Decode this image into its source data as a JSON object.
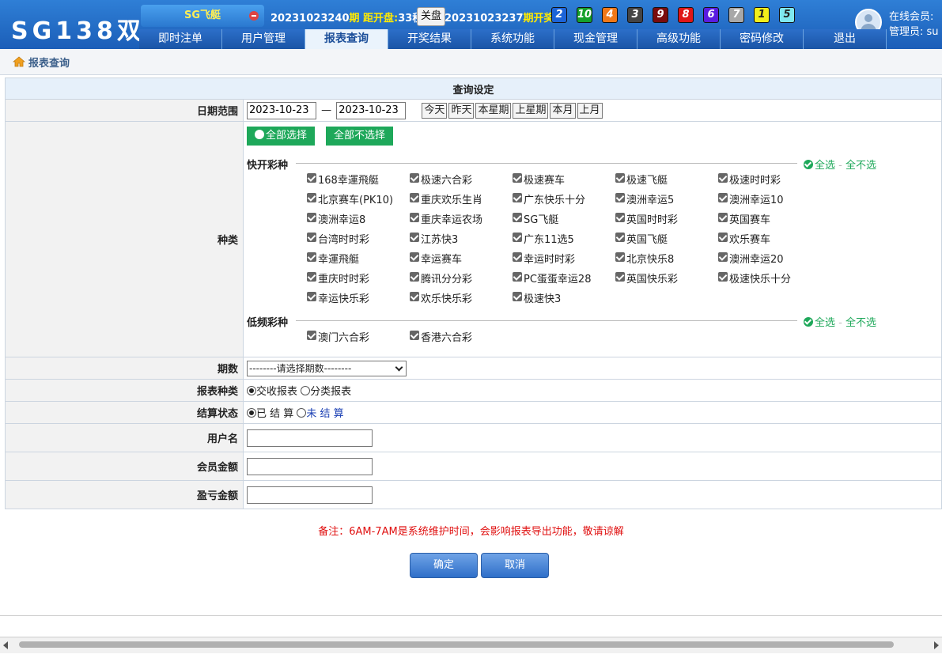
{
  "brand": {
    "logo": "SG138双"
  },
  "top": {
    "game_name": "SG飞艇",
    "period_current": "20231023240",
    "period_suffix": "期",
    "countdown_label": "距开盘:",
    "countdown_value": "33秒",
    "close_button": "关盘",
    "last_period": "20231023237",
    "last_label": "期开奖:",
    "balls": [
      {
        "num": "2",
        "color": "#1c64d8"
      },
      {
        "num": "10",
        "color": "#16a02b"
      },
      {
        "num": "4",
        "color": "#f07818"
      },
      {
        "num": "3",
        "color": "#444444"
      },
      {
        "num": "9",
        "color": "#7a0c0c"
      },
      {
        "num": "8",
        "color": "#e01616"
      },
      {
        "num": "6",
        "color": "#5a1ce0"
      },
      {
        "num": "7",
        "color": "#a8a8a8"
      },
      {
        "num": "1",
        "color": "#f2ee1a"
      },
      {
        "num": "5",
        "color": "#7fe8f0"
      }
    ],
    "online_label": "在线会员:",
    "admin_label": "管理员: su"
  },
  "nav": {
    "items": [
      "即时注单",
      "用户管理",
      "报表查询",
      "开奖结果",
      "系统功能",
      "现金管理",
      "高级功能",
      "密码修改",
      "退出"
    ],
    "active": "报表查询"
  },
  "breadcrumb": "报表查询",
  "form": {
    "header": "查询设定",
    "date_label": "日期范围",
    "date_from": "2023-10-23",
    "date_sep": "—",
    "date_to": "2023-10-23",
    "quick_dates": [
      "今天",
      "昨天",
      "本星期",
      "上星期",
      "本月",
      "上月"
    ],
    "type_label": "种类",
    "select_all": "全部选择",
    "select_none": "全部不选择",
    "fast_title": "快开彩种",
    "fast_games": [
      "168幸運飛艇",
      "极速六合彩",
      "极速赛车",
      "极速飞艇",
      "极速时时彩",
      "北京赛车(PK10)",
      "重庆欢乐生肖",
      "广东快乐十分",
      "澳洲幸运5",
      "澳洲幸运10",
      "澳洲幸运8",
      "重庆幸运农场",
      "SG飞艇",
      "英国时时彩",
      "英国赛车",
      "台湾时时彩",
      "江苏快3",
      "广东11选5",
      "英国飞艇",
      "欢乐赛车",
      "幸運飛艇",
      "幸运赛车",
      "幸运时时彩",
      "北京快乐8",
      "澳洲幸运20",
      "重庆时时彩",
      "腾讯分分彩",
      "PC蛋蛋幸运28",
      "英国快乐彩",
      "极速快乐十分",
      "幸运快乐彩",
      "欢乐快乐彩",
      "极速快3"
    ],
    "slow_title": "低频彩种",
    "slow_games": [
      "澳门六合彩",
      "香港六合彩"
    ],
    "all_link": "全选",
    "none_link": "全不选",
    "period_label": "期数",
    "period_placeholder": "--------请选择期数--------",
    "report_label": "报表种类",
    "report_options": [
      "交收报表",
      "分类报表"
    ],
    "settle_label": "结算状态",
    "settle_options": [
      "已 结 算",
      "未 结 算"
    ],
    "username_label": "用户名",
    "member_amount_label": "会员金额",
    "profit_label": "盈亏金额"
  },
  "note": "备注：6AM-7AM是系统维护时间，会影响报表导出功能，敬请谅解",
  "actions": {
    "confirm": "确定",
    "cancel": "取消"
  },
  "colors": {
    "header": "#1b5eb8",
    "accent_green": "#1ea85a",
    "note_red": "#e01010"
  }
}
